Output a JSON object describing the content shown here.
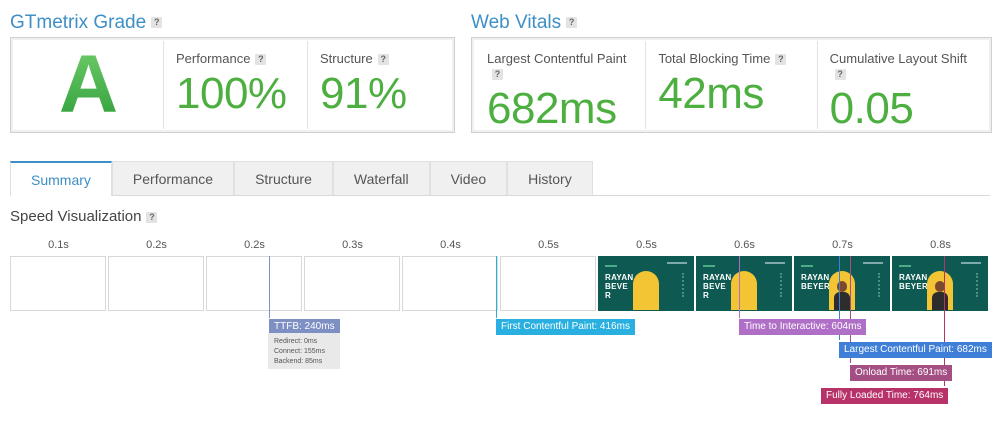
{
  "grade": {
    "title": "GTmetrix Grade",
    "letter": "A",
    "help": "?"
  },
  "grade_metrics": [
    {
      "label": "Performance",
      "value": "100%"
    },
    {
      "label": "Structure",
      "value": "91%"
    }
  ],
  "vitals": {
    "title": "Web Vitals",
    "help": "?"
  },
  "vitals_metrics": [
    {
      "label": "Largest Contentful Paint",
      "value": "682ms"
    },
    {
      "label": "Total Blocking Time",
      "value": "42ms"
    },
    {
      "label": "Cumulative Layout Shift",
      "value": "0.05"
    }
  ],
  "tabs": [
    "Summary",
    "Performance",
    "Structure",
    "Waterfall",
    "Video",
    "History"
  ],
  "active_tab": "Summary",
  "speed_visualization": {
    "title": "Speed Visualization",
    "times": [
      "0.1s",
      "0.2s",
      "0.2s",
      "0.3s",
      "0.4s",
      "0.5s",
      "0.5s",
      "0.6s",
      "0.7s",
      "0.8s"
    ],
    "thumb_text": [
      "RAYAN\nBEVE\nR",
      "RAYAN\nBEVE\nR",
      "RAYAN\nBEYER",
      "RAYAN\nBEYER"
    ]
  },
  "markers": {
    "ttfb": "TTFB: 240ms",
    "ttfb_detail": [
      "Redirect: 0ms",
      "Connect: 155ms",
      "Backend: 85ms"
    ],
    "fcp": "First Contentful Paint: 416ms",
    "tti": "Time to Interactive: 604ms",
    "lcp": "Largest Contentful Paint: 682ms",
    "onload": "Onload Time: 691ms",
    "fully_loaded": "Fully Loaded Time: 764ms"
  },
  "colors": {
    "accent": "#3d8fc6",
    "grade_green": "#4caf3f",
    "ttfb": "#7d8fc3",
    "fcp": "#29b0e0",
    "tti": "#b06fc6",
    "lcp": "#3f7fd8",
    "onload": "#a44f84",
    "fully_loaded": "#b8326a"
  }
}
